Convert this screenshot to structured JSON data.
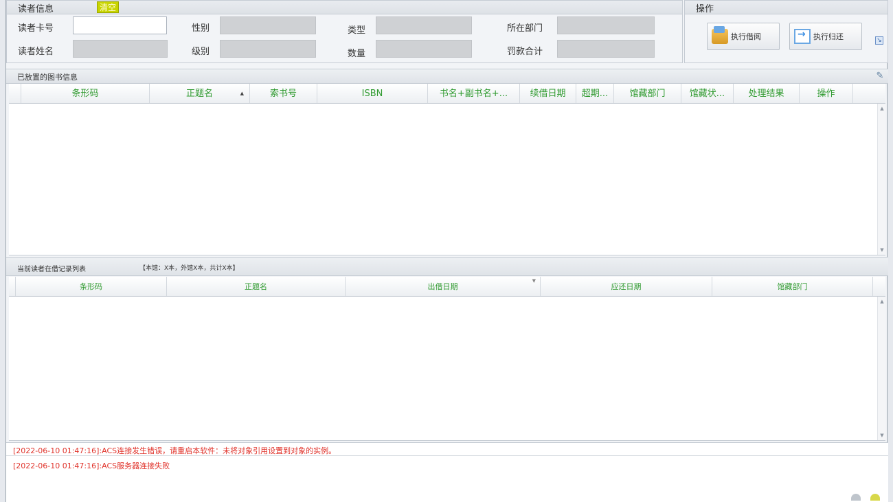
{
  "reader_info": {
    "title": "读者信息",
    "clear_label": "清空",
    "fields": {
      "card_no": {
        "label": "读者卡号",
        "value": ""
      },
      "name": {
        "label": "读者姓名",
        "value": ""
      },
      "gender": {
        "label": "性别",
        "value": ""
      },
      "level": {
        "label": "级别",
        "value": ""
      },
      "type": {
        "label": "类型",
        "value": ""
      },
      "quantity": {
        "label": "数量",
        "value": ""
      },
      "department": {
        "label": "所在部门",
        "value": ""
      },
      "fine_total": {
        "label": "罚款合计",
        "value": ""
      }
    }
  },
  "operations": {
    "title": "操作",
    "borrow_label": "执行借阅",
    "return_label": "执行归还"
  },
  "placed_books": {
    "title": "已放置的图书信息",
    "columns": [
      "条形码",
      "正题名",
      "索书号",
      "ISBN",
      "书名+副书名+...",
      "续借日期",
      "超期...",
      "馆藏部门",
      "馆藏状...",
      "处理结果",
      "操作"
    ],
    "sort_marker": "▲",
    "rows": []
  },
  "current_records": {
    "title": "当前读者在借记录列表",
    "count_text": "【本馆：X本，外馆X本，共计X本】",
    "columns": [
      "条形码",
      "正题名",
      "出借日期",
      "应还日期",
      "馆藏部门"
    ],
    "filter_marker": "▼",
    "rows": []
  },
  "log": [
    "[2022-06-10 01:47:16]:ACS连接发生错误，请重启本软件：未将对象引用设置到对象的实例。",
    "[2022-06-10 01:47:16]:ACS服务器连接失败"
  ],
  "colors": {
    "header_text": "#2f9a2f",
    "log_text": "#e0322a",
    "clear_button": "#c8d400"
  }
}
